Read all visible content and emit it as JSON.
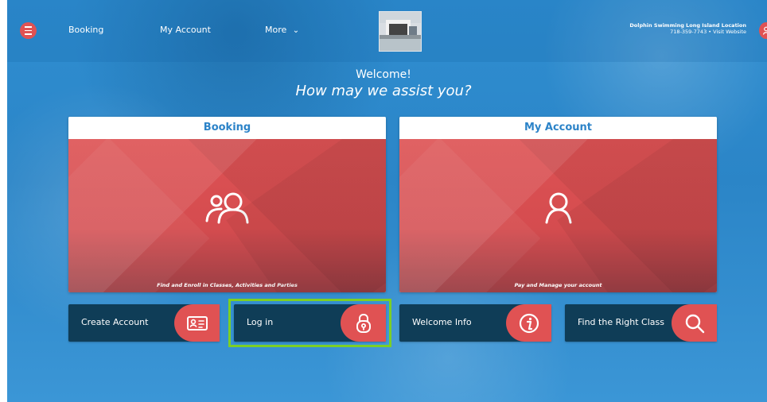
{
  "nav": {
    "booking": "Booking",
    "my_account": "My Account",
    "more": "More",
    "more_chevron": "⌄"
  },
  "location": {
    "name": "Dolphin Swimming Long Island Location",
    "contact": "718-359-7743 • Visit Website"
  },
  "hero": {
    "greeting": "Welcome!",
    "prompt": "How may we assist you?"
  },
  "cards": [
    {
      "title": "Booking",
      "caption": "Find and Enroll in Classes, Activities and Parties",
      "icon": "users-icon"
    },
    {
      "title": "My Account",
      "caption": "Pay and Manage your account",
      "icon": "user-icon"
    }
  ],
  "actions": [
    {
      "label": "Create Account",
      "icon": "id-card-icon"
    },
    {
      "label": "Log in",
      "icon": "lock-icon"
    },
    {
      "label": "Welcome Info",
      "icon": "info-icon"
    },
    {
      "label": "Find the Right Class",
      "icon": "search-icon"
    }
  ],
  "colors": {
    "accent": "#e05253",
    "dark_button": "#0f3d57",
    "highlight": "#7ccf25",
    "card_title": "#2c83c8"
  }
}
